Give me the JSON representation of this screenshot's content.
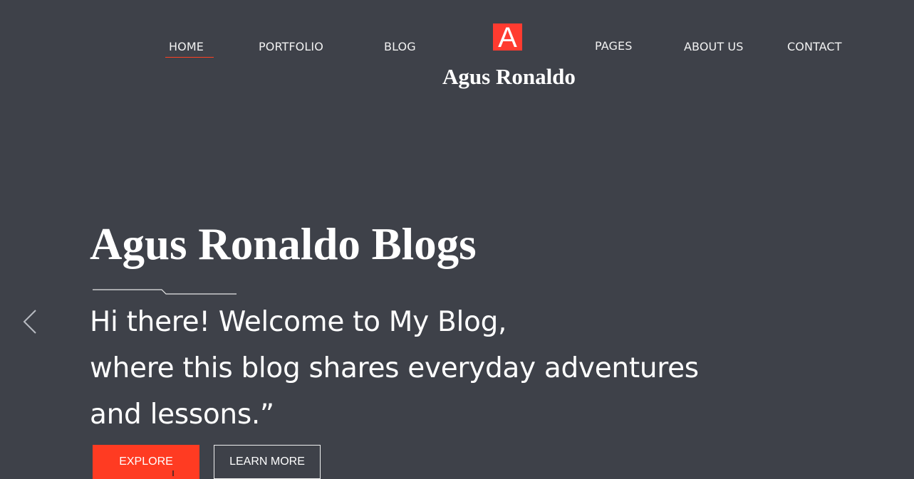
{
  "nav": {
    "left_items": [
      {
        "label": "HOME",
        "active": true
      },
      {
        "label": "PORTFOLIO"
      },
      {
        "label": "BLOG"
      }
    ],
    "right_items": [
      {
        "label": "PAGES"
      },
      {
        "label": "ABOUT US"
      },
      {
        "label": "CONTACT"
      }
    ],
    "active_underline_color": "#ff4122"
  },
  "logo": {
    "mark": "A",
    "name": "Agus Ronaldo",
    "mark_color": "#ff3b30"
  },
  "hero": {
    "title": "Agus Ronaldo Blogs",
    "lines": [
      "Hi there! Welcome to My Blog,",
      "where this blog shares everyday adventures",
      "and lessons.”"
    ],
    "explore_label": "EXPLORE",
    "learn_more_label": "LEARN MORE",
    "accent_color": "#ff3b22",
    "background_color": "#3e4149"
  },
  "slider": {
    "prev_icon": "chevron-left-icon"
  }
}
